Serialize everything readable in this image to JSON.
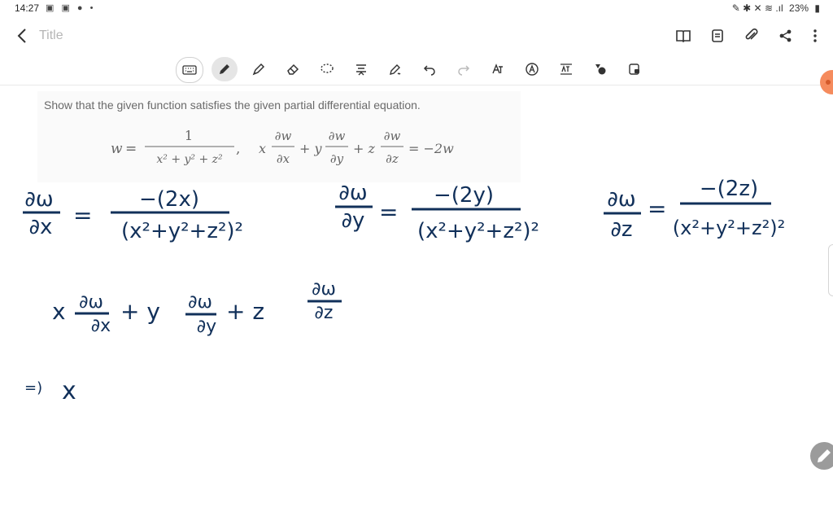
{
  "status_bar": {
    "time": "14:27",
    "left_icons": "▣ ▣ ● •",
    "right_icons": "✎ ✱ ✕ ≋ .ıl",
    "battery": "23%",
    "battery_icon": "▮"
  },
  "header": {
    "title": "Title",
    "back_icon": "chevron-left-icon",
    "actions": [
      "book-icon",
      "page-view-icon",
      "attach-icon",
      "share-icon",
      "more-icon"
    ]
  },
  "toolbar": {
    "tools": [
      "keyboard-icon",
      "pen-icon",
      "highlighter-icon",
      "eraser-icon",
      "lasso-icon",
      "text-align-icon",
      "pen-settings-icon",
      "undo-icon",
      "redo-icon",
      "handwriting-text-icon",
      "text-mode-icon",
      "text-fit-icon",
      "shape-icon",
      "lock-icon"
    ],
    "active_tool": "pen-icon"
  },
  "problem": {
    "text": "Show that the given function satisfies the given partial differential equation.",
    "eq_w": "w",
    "eq_equals": "=",
    "eq_num": "1",
    "eq_den": "x² + y² + z²",
    "eq_comma": ",",
    "pde_x": "x",
    "pde_dw1": "∂w",
    "pde_dx": "∂x",
    "pde_plus1": "+ y",
    "pde_dw2": "∂w",
    "pde_dy": "∂y",
    "pde_plus2": "+ z",
    "pde_dw3": "∂w",
    "pde_dz": "∂z",
    "pde_rhs": "= −2w"
  },
  "handwriting": {
    "dwdx_num": "∂ω",
    "dwdx_den": "∂x",
    "dwdx_rhs_num": "−(2x)",
    "dwdx_rhs_den": "(x²+y²+z²)²",
    "dwdy_num": "∂ω",
    "dwdy_den": "∂y",
    "dwdy_rhs_num": "−(2y)",
    "dwdy_rhs_den": "(x²+y²+z²)²",
    "dwdz_num": "∂ω",
    "dwdz_den": "∂z",
    "dwdz_rhs_num": "−(2z)",
    "dwdz_rhs_den": "(x²+y²+z²)²",
    "eq": "=",
    "sum_x": "x",
    "sum_dw1": "∂ω",
    "sum_dx": "∂x",
    "sum_plus_y": "+ y",
    "sum_dw2": "∂ω",
    "sum_dy": "∂y",
    "sum_plus_z": "+ z",
    "sum_dw3": "∂ω",
    "sum_dz": "∂z",
    "implies": "=)",
    "last_x": "x"
  },
  "colors": {
    "ink": "#11305a",
    "accent_orange": "#f58b5d",
    "fab_gray": "#9b9b9b"
  }
}
